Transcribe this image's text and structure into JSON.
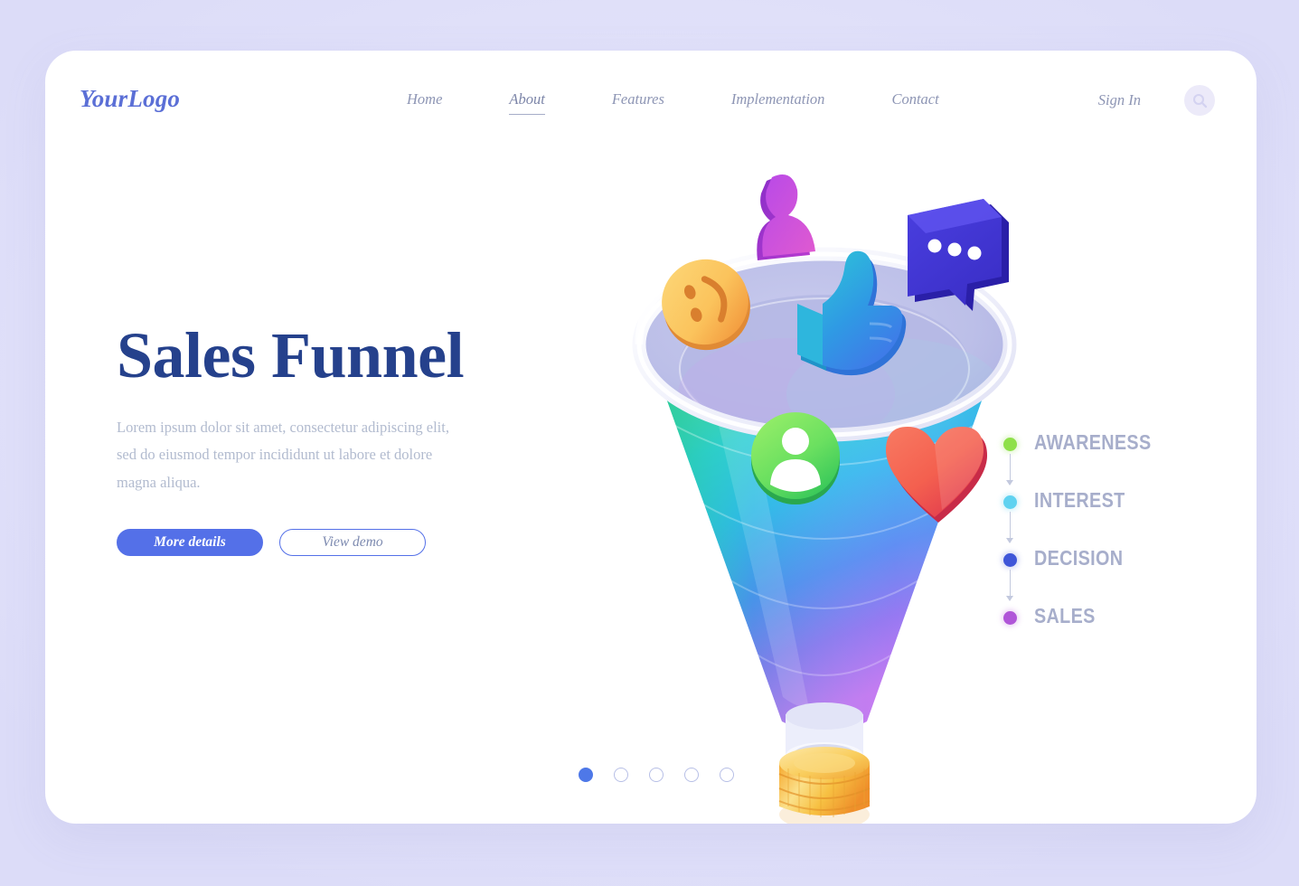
{
  "brand": {
    "logo": "YourLogo",
    "accent": "#5470e8",
    "title_color": "#25418c"
  },
  "nav": {
    "items": [
      {
        "label": "Home",
        "active": false
      },
      {
        "label": "About",
        "active": true
      },
      {
        "label": "Features",
        "active": false
      },
      {
        "label": "Implementation",
        "active": false
      },
      {
        "label": "Contact",
        "active": false
      }
    ],
    "sign_in": "Sign In",
    "search_icon": "search-icon"
  },
  "hero": {
    "title": "Sales Funnel",
    "description": "Lorem ipsum dolor sit amet, consectetur adipiscing elit, sed do eiusmod tempor incididunt ut labore et dolore magna aliqua.",
    "primary_button": "More details",
    "secondary_button": "View demo"
  },
  "illustration": {
    "name": "isometric-sales-funnel",
    "funnel_gradient": [
      "#49e0a8",
      "#5fe08a",
      "#2fd0d8",
      "#3aa7f0",
      "#7a6bf0",
      "#b66cf0"
    ],
    "bowl_color": "#b9bbe6",
    "rim_color": "#f2f3fb",
    "coins_color": "#f5c04a",
    "icons": [
      {
        "name": "person-silhouette-icon",
        "color": "#c05ae0"
      },
      {
        "name": "smiley-face-icon",
        "color": "#f8c55a"
      },
      {
        "name": "thumbs-up-icon",
        "color": "#2f9fe0"
      },
      {
        "name": "speech-bubble-icon",
        "color": "#3a34c8"
      },
      {
        "name": "user-avatar-icon",
        "color": "#7ae055"
      },
      {
        "name": "heart-icon",
        "color": "#f4665a"
      }
    ]
  },
  "stages": [
    {
      "label": "AWARENESS",
      "color": "#8fe04a"
    },
    {
      "label": "INTEREST",
      "color": "#5fd2f0"
    },
    {
      "label": "DECISION",
      "color": "#3f56d8"
    },
    {
      "label": "SALES",
      "color": "#b055d8"
    }
  ],
  "carousel": {
    "total": 5,
    "active_index": 1,
    "dots": [
      "1",
      "2",
      "3",
      "4",
      "5"
    ]
  }
}
